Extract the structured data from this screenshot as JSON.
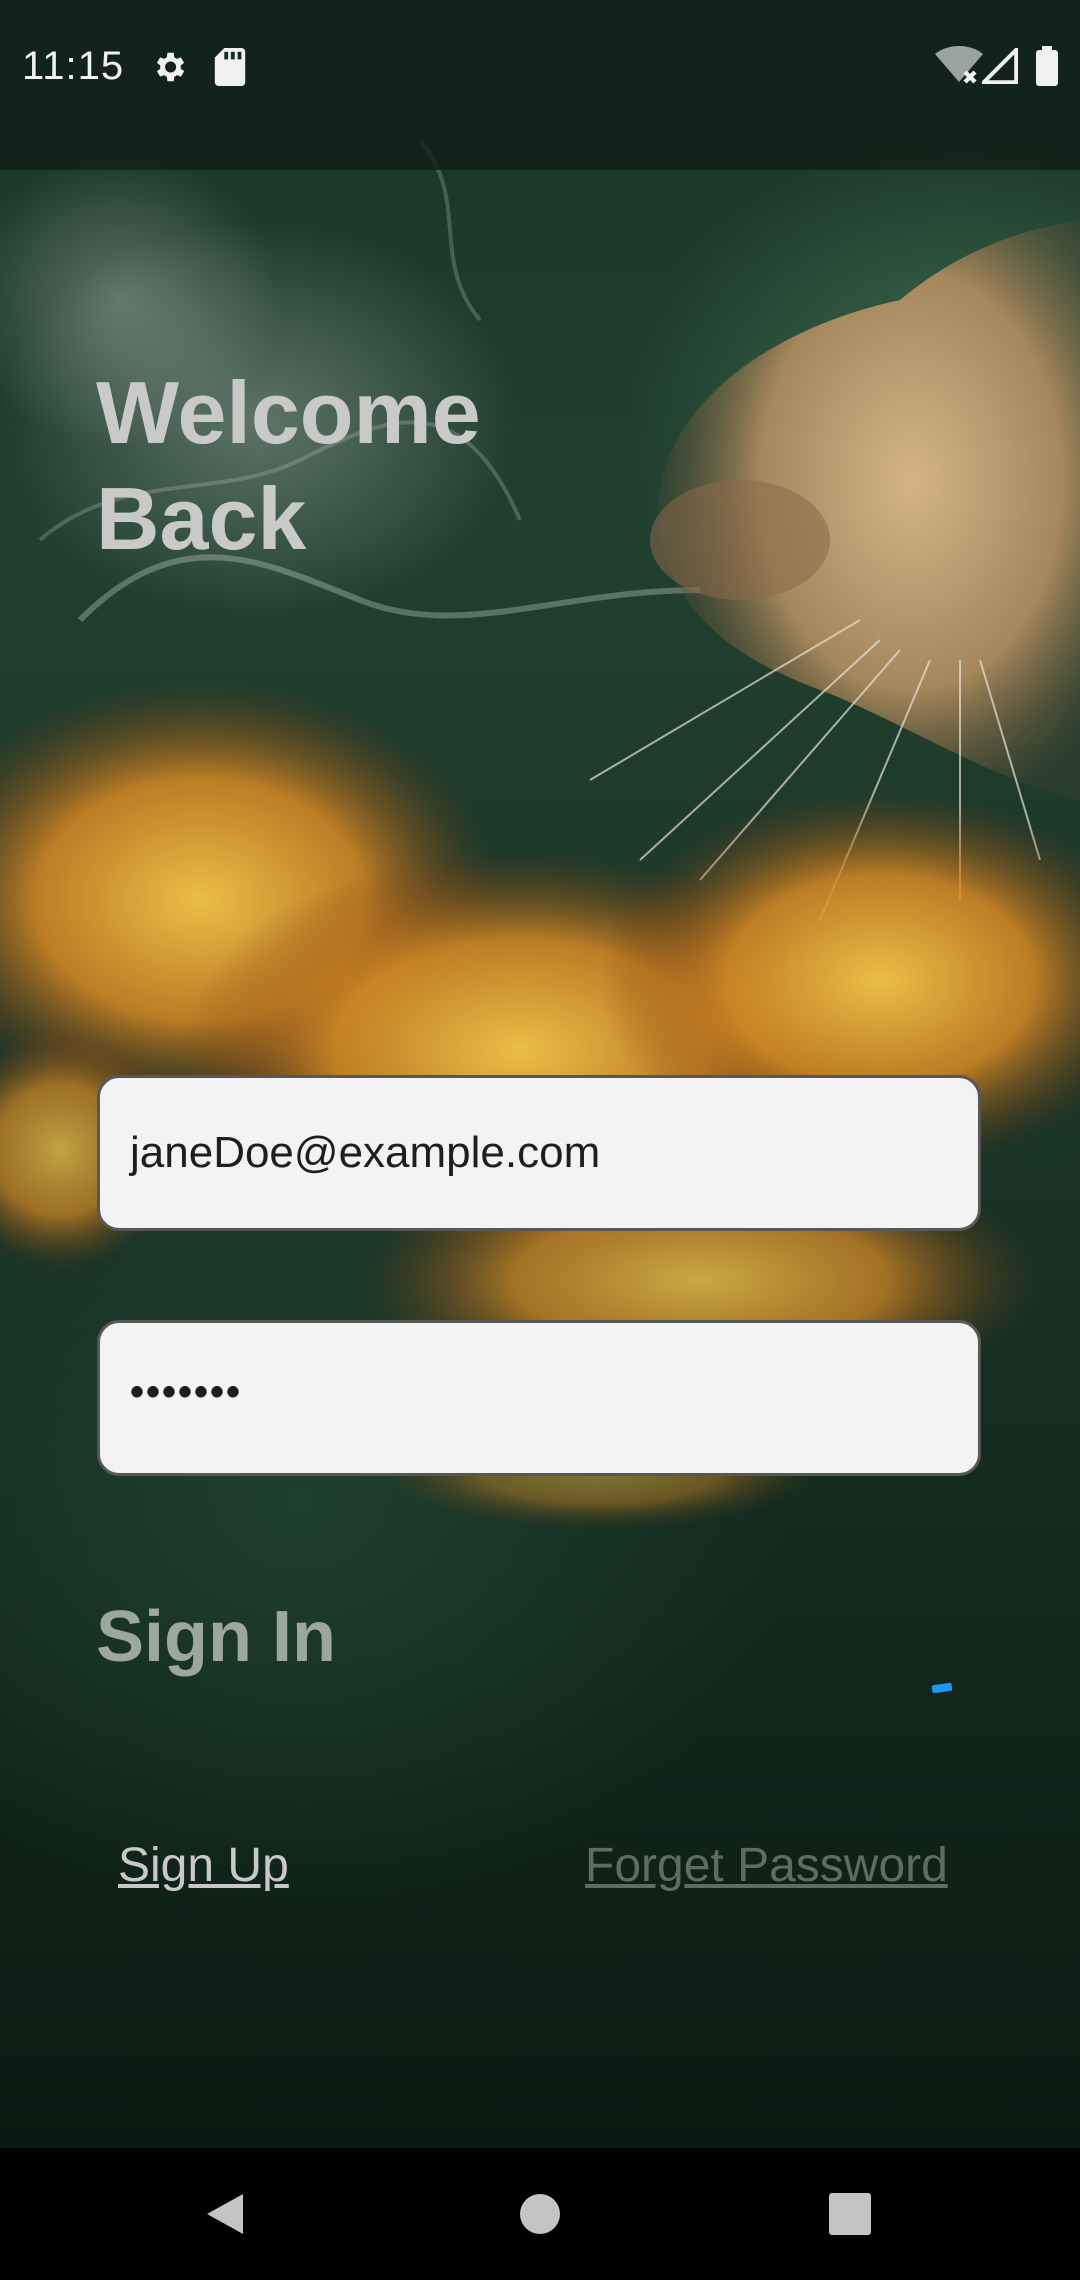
{
  "status_bar": {
    "time": "11:15",
    "icons": [
      "gear-icon",
      "sd-card-icon",
      "wifi-off-icon",
      "cell-signal-icon",
      "battery-icon"
    ]
  },
  "login": {
    "heading_line1": "Welcome",
    "heading_line2": "Back",
    "email_value": "janeDoe@example.com",
    "password_value": "•••••••",
    "sign_in_label": "Sign In",
    "sign_up_link": "Sign Up",
    "forget_password_link": "Forget Password"
  },
  "nav_bar": {
    "buttons": [
      "back-icon",
      "home-icon",
      "recents-icon"
    ]
  },
  "colors": {
    "background_dark_green": "#1a3326",
    "field_bg": "#f3f3f3",
    "spinner_accent": "#2196f3",
    "sign_in_text": "#9da6a0",
    "forget_link_text": "#5e6d63"
  }
}
